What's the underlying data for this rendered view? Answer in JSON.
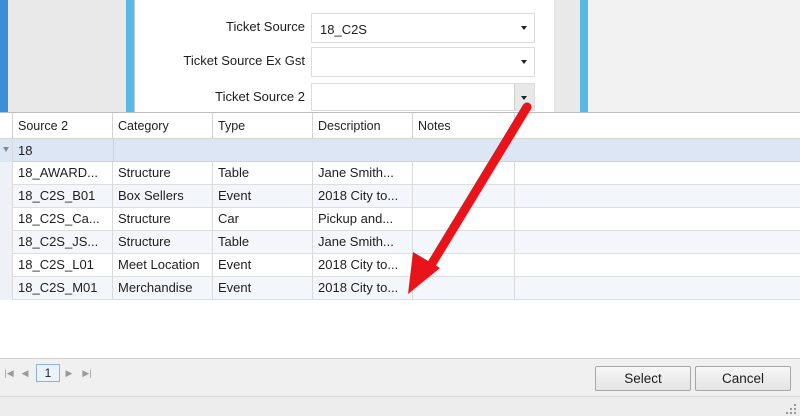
{
  "form": {
    "ticket_source_label": "Ticket Source",
    "ticket_source_value": "18_C2S",
    "ticket_source_ex_gst_label": "Ticket Source Ex Gst",
    "ticket_source_ex_gst_value": "",
    "ticket_source_2_label": "Ticket Source 2",
    "ticket_source_2_value": ""
  },
  "grid": {
    "columns": [
      "Source 2",
      "Category",
      "Type",
      "Description",
      "Notes"
    ],
    "filter_value": "18",
    "rows": [
      {
        "source": "18_AWARD...",
        "category": "Structure",
        "type": "Table",
        "description": "Jane Smith...",
        "notes": ""
      },
      {
        "source": "18_C2S_B01",
        "category": "Box Sellers",
        "type": "Event",
        "description": "2018 City to...",
        "notes": ""
      },
      {
        "source": "18_C2S_Ca...",
        "category": "Structure",
        "type": "Car",
        "description": "Pickup and...",
        "notes": ""
      },
      {
        "source": "18_C2S_JS...",
        "category": "Structure",
        "type": "Table",
        "description": "Jane Smith...",
        "notes": ""
      },
      {
        "source": "18_C2S_L01",
        "category": "Meet Location",
        "type": "Event",
        "description": "2018 City to...",
        "notes": ""
      },
      {
        "source": "18_C2S_M01",
        "category": "Merchandise",
        "type": "Event",
        "description": "2018 City to...",
        "notes": ""
      }
    ]
  },
  "pager": {
    "current_page": "1",
    "first_icon": "first-page-icon",
    "prev_icon": "prev-page-icon",
    "next_icon": "next-page-icon",
    "last_icon": "last-page-icon"
  },
  "buttons": {
    "select": "Select",
    "cancel": "Cancel"
  },
  "annotation": {
    "arrow_color": "#e8141a"
  },
  "colors": {
    "accent_blue": "#57b8e6",
    "filter_row": "#dce6f5"
  }
}
